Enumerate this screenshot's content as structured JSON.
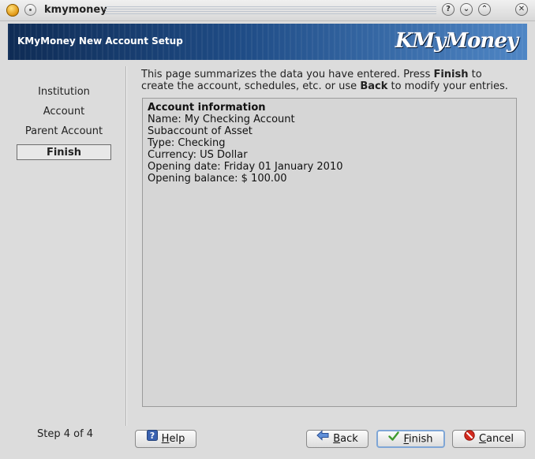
{
  "window": {
    "title": "kmymoney",
    "buttons": {
      "help": "?",
      "minimize": "⌄",
      "maximize": "⌃",
      "close": "✕"
    }
  },
  "banner": {
    "title": "KMyMoney New Account Setup",
    "logo": "KMyMoney"
  },
  "steps": [
    {
      "label": "Institution",
      "active": false
    },
    {
      "label": "Account",
      "active": false
    },
    {
      "label": "Parent Account",
      "active": false
    },
    {
      "label": "Finish",
      "active": true
    }
  ],
  "step_indicator": "Step 4 of 4",
  "intro": {
    "part1": "This page summarizes the data you have entered. Press ",
    "finish_word": "Finish",
    "part2": " to create the account, schedules, etc. or use ",
    "back_word": "Back",
    "part3": " to modify your entries."
  },
  "summary": {
    "heading": "Account information",
    "lines": [
      "Name: My Checking Account",
      "Subaccount of Asset",
      "Type: Checking",
      "Currency: US Dollar",
      "Opening date: Friday 01 January 2010",
      "Opening balance: $ 100.00"
    ]
  },
  "buttons": {
    "help": {
      "label_first": "H",
      "label_rest": "elp"
    },
    "back": {
      "label_first": "B",
      "label_rest": "ack"
    },
    "finish": {
      "label_first": "F",
      "label_rest": "inish"
    },
    "cancel": {
      "label_first": "C",
      "label_rest": "ancel"
    }
  },
  "colors": {
    "banner_dark": "#0f2c55",
    "banner_light": "#4f86c5",
    "default_button_border": "#7fa6d6"
  }
}
